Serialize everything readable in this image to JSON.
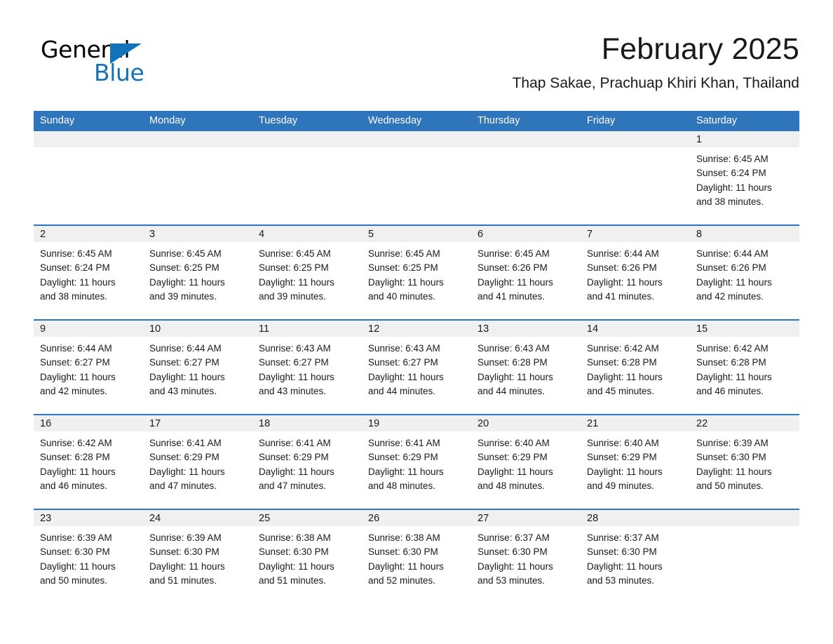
{
  "logo": {
    "word_one": "General",
    "word_two": "Blue",
    "triangle_color": "#1272ba"
  },
  "header": {
    "title": "February 2025",
    "subtitle": "Thap Sakae, Prachuap Khiri Khan, Thailand"
  },
  "colors": {
    "header_blue": "#2f75bc",
    "daynum_band": "#f0f0f0",
    "text": "#1a1a1a"
  },
  "calendar": {
    "day_names": [
      "Sunday",
      "Monday",
      "Tuesday",
      "Wednesday",
      "Thursday",
      "Friday",
      "Saturday"
    ],
    "weeks": [
      [
        {
          "day": "",
          "empty": true
        },
        {
          "day": "",
          "empty": true
        },
        {
          "day": "",
          "empty": true
        },
        {
          "day": "",
          "empty": true
        },
        {
          "day": "",
          "empty": true
        },
        {
          "day": "",
          "empty": true
        },
        {
          "day": "1",
          "sunrise": "Sunrise: 6:45 AM",
          "sunset": "Sunset: 6:24 PM",
          "daylight_1": "Daylight: 11 hours",
          "daylight_2": "and 38 minutes."
        }
      ],
      [
        {
          "day": "2",
          "sunrise": "Sunrise: 6:45 AM",
          "sunset": "Sunset: 6:24 PM",
          "daylight_1": "Daylight: 11 hours",
          "daylight_2": "and 38 minutes."
        },
        {
          "day": "3",
          "sunrise": "Sunrise: 6:45 AM",
          "sunset": "Sunset: 6:25 PM",
          "daylight_1": "Daylight: 11 hours",
          "daylight_2": "and 39 minutes."
        },
        {
          "day": "4",
          "sunrise": "Sunrise: 6:45 AM",
          "sunset": "Sunset: 6:25 PM",
          "daylight_1": "Daylight: 11 hours",
          "daylight_2": "and 39 minutes."
        },
        {
          "day": "5",
          "sunrise": "Sunrise: 6:45 AM",
          "sunset": "Sunset: 6:25 PM",
          "daylight_1": "Daylight: 11 hours",
          "daylight_2": "and 40 minutes."
        },
        {
          "day": "6",
          "sunrise": "Sunrise: 6:45 AM",
          "sunset": "Sunset: 6:26 PM",
          "daylight_1": "Daylight: 11 hours",
          "daylight_2": "and 41 minutes."
        },
        {
          "day": "7",
          "sunrise": "Sunrise: 6:44 AM",
          "sunset": "Sunset: 6:26 PM",
          "daylight_1": "Daylight: 11 hours",
          "daylight_2": "and 41 minutes."
        },
        {
          "day": "8",
          "sunrise": "Sunrise: 6:44 AM",
          "sunset": "Sunset: 6:26 PM",
          "daylight_1": "Daylight: 11 hours",
          "daylight_2": "and 42 minutes."
        }
      ],
      [
        {
          "day": "9",
          "sunrise": "Sunrise: 6:44 AM",
          "sunset": "Sunset: 6:27 PM",
          "daylight_1": "Daylight: 11 hours",
          "daylight_2": "and 42 minutes."
        },
        {
          "day": "10",
          "sunrise": "Sunrise: 6:44 AM",
          "sunset": "Sunset: 6:27 PM",
          "daylight_1": "Daylight: 11 hours",
          "daylight_2": "and 43 minutes."
        },
        {
          "day": "11",
          "sunrise": "Sunrise: 6:43 AM",
          "sunset": "Sunset: 6:27 PM",
          "daylight_1": "Daylight: 11 hours",
          "daylight_2": "and 43 minutes."
        },
        {
          "day": "12",
          "sunrise": "Sunrise: 6:43 AM",
          "sunset": "Sunset: 6:27 PM",
          "daylight_1": "Daylight: 11 hours",
          "daylight_2": "and 44 minutes."
        },
        {
          "day": "13",
          "sunrise": "Sunrise: 6:43 AM",
          "sunset": "Sunset: 6:28 PM",
          "daylight_1": "Daylight: 11 hours",
          "daylight_2": "and 44 minutes."
        },
        {
          "day": "14",
          "sunrise": "Sunrise: 6:42 AM",
          "sunset": "Sunset: 6:28 PM",
          "daylight_1": "Daylight: 11 hours",
          "daylight_2": "and 45 minutes."
        },
        {
          "day": "15",
          "sunrise": "Sunrise: 6:42 AM",
          "sunset": "Sunset: 6:28 PM",
          "daylight_1": "Daylight: 11 hours",
          "daylight_2": "and 46 minutes."
        }
      ],
      [
        {
          "day": "16",
          "sunrise": "Sunrise: 6:42 AM",
          "sunset": "Sunset: 6:28 PM",
          "daylight_1": "Daylight: 11 hours",
          "daylight_2": "and 46 minutes."
        },
        {
          "day": "17",
          "sunrise": "Sunrise: 6:41 AM",
          "sunset": "Sunset: 6:29 PM",
          "daylight_1": "Daylight: 11 hours",
          "daylight_2": "and 47 minutes."
        },
        {
          "day": "18",
          "sunrise": "Sunrise: 6:41 AM",
          "sunset": "Sunset: 6:29 PM",
          "daylight_1": "Daylight: 11 hours",
          "daylight_2": "and 47 minutes."
        },
        {
          "day": "19",
          "sunrise": "Sunrise: 6:41 AM",
          "sunset": "Sunset: 6:29 PM",
          "daylight_1": "Daylight: 11 hours",
          "daylight_2": "and 48 minutes."
        },
        {
          "day": "20",
          "sunrise": "Sunrise: 6:40 AM",
          "sunset": "Sunset: 6:29 PM",
          "daylight_1": "Daylight: 11 hours",
          "daylight_2": "and 48 minutes."
        },
        {
          "day": "21",
          "sunrise": "Sunrise: 6:40 AM",
          "sunset": "Sunset: 6:29 PM",
          "daylight_1": "Daylight: 11 hours",
          "daylight_2": "and 49 minutes."
        },
        {
          "day": "22",
          "sunrise": "Sunrise: 6:39 AM",
          "sunset": "Sunset: 6:30 PM",
          "daylight_1": "Daylight: 11 hours",
          "daylight_2": "and 50 minutes."
        }
      ],
      [
        {
          "day": "23",
          "sunrise": "Sunrise: 6:39 AM",
          "sunset": "Sunset: 6:30 PM",
          "daylight_1": "Daylight: 11 hours",
          "daylight_2": "and 50 minutes."
        },
        {
          "day": "24",
          "sunrise": "Sunrise: 6:39 AM",
          "sunset": "Sunset: 6:30 PM",
          "daylight_1": "Daylight: 11 hours",
          "daylight_2": "and 51 minutes."
        },
        {
          "day": "25",
          "sunrise": "Sunrise: 6:38 AM",
          "sunset": "Sunset: 6:30 PM",
          "daylight_1": "Daylight: 11 hours",
          "daylight_2": "and 51 minutes."
        },
        {
          "day": "26",
          "sunrise": "Sunrise: 6:38 AM",
          "sunset": "Sunset: 6:30 PM",
          "daylight_1": "Daylight: 11 hours",
          "daylight_2": "and 52 minutes."
        },
        {
          "day": "27",
          "sunrise": "Sunrise: 6:37 AM",
          "sunset": "Sunset: 6:30 PM",
          "daylight_1": "Daylight: 11 hours",
          "daylight_2": "and 53 minutes."
        },
        {
          "day": "28",
          "sunrise": "Sunrise: 6:37 AM",
          "sunset": "Sunset: 6:30 PM",
          "daylight_1": "Daylight: 11 hours",
          "daylight_2": "and 53 minutes."
        },
        {
          "day": "",
          "empty": true
        }
      ]
    ]
  }
}
